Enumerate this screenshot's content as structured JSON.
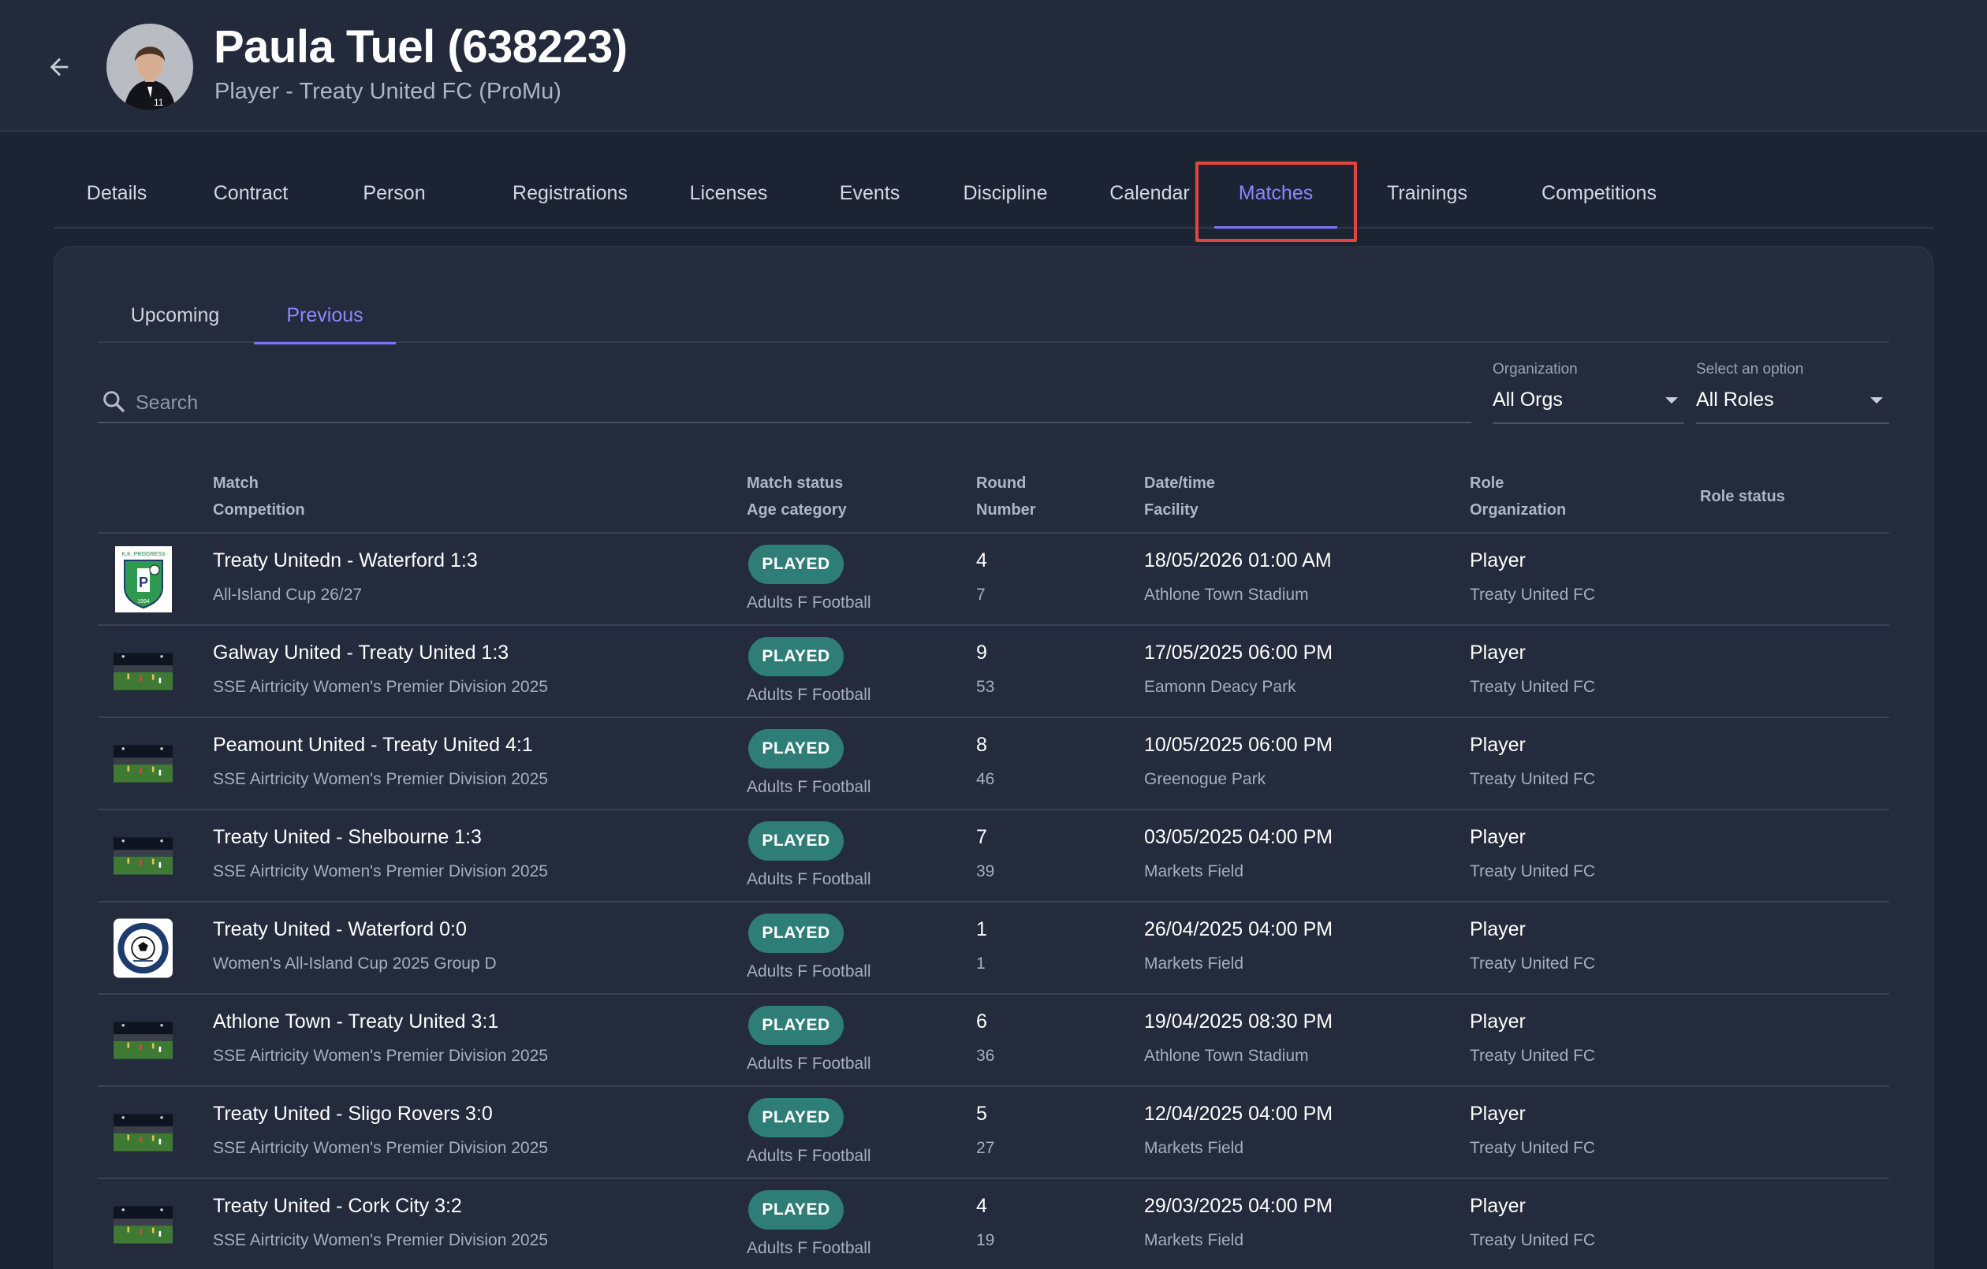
{
  "header": {
    "name": "Paula Tuel (638223)",
    "subtitle": "Player - Treaty United FC (ProMu)"
  },
  "tabs": [
    "Details",
    "Contract",
    "Person",
    "Registrations",
    "Licenses",
    "Events",
    "Discipline",
    "Calendar",
    "Matches",
    "Trainings",
    "Competitions"
  ],
  "active_tab": "Matches",
  "sub_tabs": [
    "Upcoming",
    "Previous"
  ],
  "active_sub_tab": "Previous",
  "search": {
    "placeholder": "Search"
  },
  "filters": {
    "organization": {
      "label": "Organization",
      "value": "All Orgs"
    },
    "role": {
      "label": "Select an option",
      "value": "All Roles"
    }
  },
  "table": {
    "headers": {
      "match": "Match",
      "competition": "Competition",
      "status": "Match status",
      "age": "Age category",
      "round": "Round",
      "number": "Number",
      "datetime": "Date/time",
      "facility": "Facility",
      "role": "Role",
      "organization": "Organization",
      "role_status": "Role status"
    },
    "rows": [
      {
        "thumb": "club-crest",
        "match": "Treaty Unitedn - Waterford 1:3",
        "competition": "All-Island Cup 26/27",
        "status": "PLAYED",
        "age": "Adults F Football",
        "round": "4",
        "number": "7",
        "datetime": "18/05/2026 01:00 AM",
        "facility": "Athlone Town Stadium",
        "role": "Player",
        "organization": "Treaty United FC"
      },
      {
        "thumb": "stadium",
        "match": "Galway United - Treaty United 1:3",
        "competition": "SSE Airtricity Women's Premier Division 2025",
        "status": "PLAYED",
        "age": "Adults F Football",
        "round": "9",
        "number": "53",
        "datetime": "17/05/2025 06:00 PM",
        "facility": "Eamonn Deacy Park",
        "role": "Player",
        "organization": "Treaty United FC"
      },
      {
        "thumb": "stadium",
        "match": "Peamount United - Treaty United 4:1",
        "competition": "SSE Airtricity Women's Premier Division 2025",
        "status": "PLAYED",
        "age": "Adults F Football",
        "round": "8",
        "number": "46",
        "datetime": "10/05/2025 06:00 PM",
        "facility": "Greenogue Park",
        "role": "Player",
        "organization": "Treaty United FC"
      },
      {
        "thumb": "stadium",
        "match": "Treaty United - Shelbourne 1:3",
        "competition": "SSE Airtricity Women's Premier Division 2025",
        "status": "PLAYED",
        "age": "Adults F Football",
        "round": "7",
        "number": "39",
        "datetime": "03/05/2025 04:00 PM",
        "facility": "Markets Field",
        "role": "Player",
        "organization": "Treaty United FC"
      },
      {
        "thumb": "football-club-logo",
        "match": "Treaty United - Waterford 0:0",
        "competition": "Women's All-Island Cup 2025 Group D",
        "status": "PLAYED",
        "age": "Adults F Football",
        "round": "1",
        "number": "1",
        "datetime": "26/04/2025 04:00 PM",
        "facility": "Markets Field",
        "role": "Player",
        "organization": "Treaty United FC"
      },
      {
        "thumb": "stadium",
        "match": "Athlone Town - Treaty United 3:1",
        "competition": "SSE Airtricity Women's Premier Division 2025",
        "status": "PLAYED",
        "age": "Adults F Football",
        "round": "6",
        "number": "36",
        "datetime": "19/04/2025 08:30 PM",
        "facility": "Athlone Town Stadium",
        "role": "Player",
        "organization": "Treaty United FC"
      },
      {
        "thumb": "stadium",
        "match": "Treaty United - Sligo Rovers 3:0",
        "competition": "SSE Airtricity Women's Premier Division 2025",
        "status": "PLAYED",
        "age": "Adults F Football",
        "round": "5",
        "number": "27",
        "datetime": "12/04/2025 04:00 PM",
        "facility": "Markets Field",
        "role": "Player",
        "organization": "Treaty United FC"
      },
      {
        "thumb": "stadium",
        "match": "Treaty United - Cork City 3:2",
        "competition": "SSE Airtricity Women's Premier Division 2025",
        "status": "PLAYED",
        "age": "Adults F Football",
        "round": "4",
        "number": "19",
        "datetime": "29/03/2025 04:00 PM",
        "facility": "Markets Field",
        "role": "Player",
        "organization": "Treaty United FC"
      }
    ]
  },
  "colors": {
    "accent": "#7b73ff",
    "badge": "#2f7d77",
    "highlight": "#e0463d",
    "background": "#1c2333"
  }
}
